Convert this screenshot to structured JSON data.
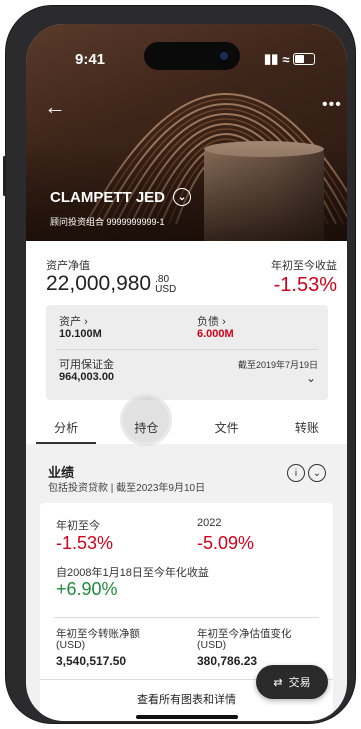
{
  "status": {
    "time": "9:41"
  },
  "header": {
    "account_name": "CLAMPETT JED",
    "portfolio": "顾问投资组合 9999999999-1"
  },
  "overview": {
    "nav_label": "资产净值",
    "nav_value": "22,000,980",
    "nav_decimal": ".80",
    "nav_currency": "USD",
    "ytd_label": "年初至今收益",
    "ytd_value": "-1.53%"
  },
  "summary": {
    "assets_label": "资产",
    "assets_value": "10.100M",
    "liabilities_label": "负债",
    "liabilities_value": "6.000M",
    "margin_label": "可用保证金",
    "margin_value": "964,003.00",
    "as_of": "截至2019年7月19日"
  },
  "tabs": [
    "分析",
    "持仓",
    "文件",
    "转账"
  ],
  "performance": {
    "title": "业绩",
    "subtitle": "包括投资贷款 | 截至2023年9月10日",
    "ytd_label": "年初至今",
    "ytd_value": "-1.53%",
    "year_label": "2022",
    "year_value": "-5.09%",
    "annualized_label": "自2008年1月18日至今年化收益",
    "annualized_value": "+6.90%",
    "net_transfer_label": "年初至今转账净额",
    "net_transfer_unit": "(USD)",
    "net_transfer_value": "3,540,517.50",
    "valuation_change_label": "年初至今净估值变化",
    "valuation_change_unit": "(USD)",
    "valuation_change_value": "380,786.23",
    "view_all": "查看所有图表和详情"
  },
  "trade_button": "交易",
  "colors": {
    "negative": "#d0021b",
    "positive": "#1f8a3a"
  }
}
